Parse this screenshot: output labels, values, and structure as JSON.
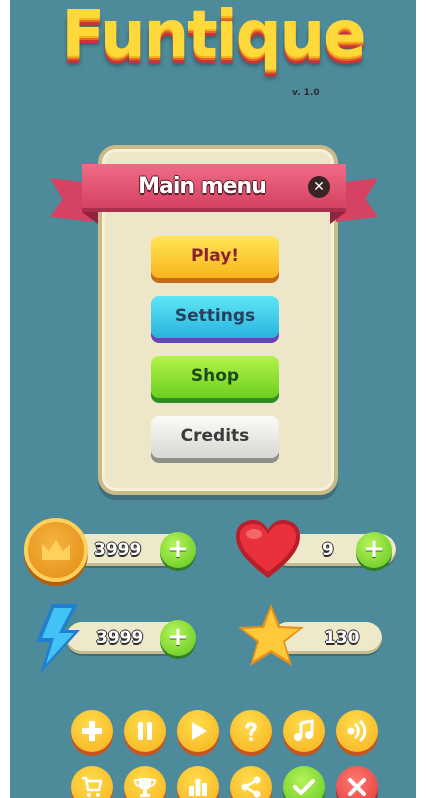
{
  "logo": {
    "title": "Funtique",
    "version": "v. 1.0"
  },
  "main_menu": {
    "title": "Main menu",
    "close_icon": "close-icon",
    "buttons": {
      "play": "Play!",
      "settings": "Settings",
      "shop": "Shop",
      "credits": "Credits"
    }
  },
  "stats": {
    "coins": {
      "icon": "crown-coin-icon",
      "value": "3999"
    },
    "lives": {
      "icon": "heart-icon",
      "value": "9"
    },
    "energy": {
      "icon": "lightning-icon",
      "value": "3999"
    },
    "stars": {
      "icon": "star-icon",
      "value": "130"
    }
  },
  "icon_buttons_row1": [
    "plus-icon",
    "pause-icon",
    "play-icon",
    "help-icon",
    "music-icon",
    "sound-icon"
  ],
  "icon_buttons_row2": [
    "cart-icon",
    "trophy-icon",
    "leaderboard-icon",
    "share-icon",
    "check-icon",
    "close-icon"
  ],
  "colors": {
    "background": "#4d8b9a",
    "panel": "#ede6c9",
    "ribbon": "#d54262",
    "play": "#f9b51d",
    "settings": "#28b3df",
    "shop": "#6ccf1f",
    "credits": "#d8d8d2",
    "icon_button": "#f7b01d"
  }
}
